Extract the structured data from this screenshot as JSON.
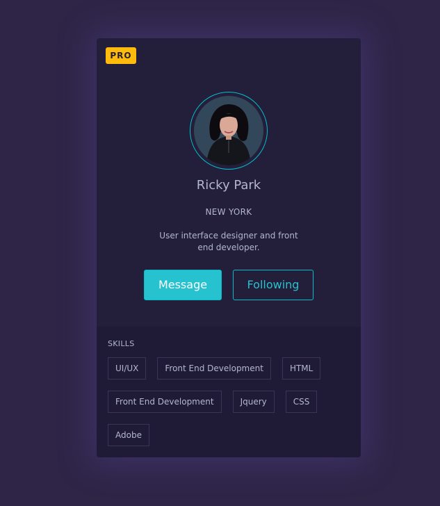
{
  "badge": "PRO",
  "profile": {
    "name": "Ricky Park",
    "city": "NEW YORK",
    "bio": "User interface designer and front end developer."
  },
  "actions": {
    "message_label": "Message",
    "following_label": "Following"
  },
  "skills": {
    "title": "SKILLS",
    "rows": [
      [
        "UI/UX",
        "Front End Development",
        "HTML"
      ],
      [
        "Front End Development",
        "Jquery",
        "CSS"
      ],
      [
        "Adobe"
      ]
    ]
  },
  "colors": {
    "accent": "#03BFCB",
    "badge": "#FEBB0B",
    "card": "#231E39",
    "skills_bg": "#1F1A36",
    "page_bg": "#2F2547",
    "text": "#B3B8CD"
  }
}
